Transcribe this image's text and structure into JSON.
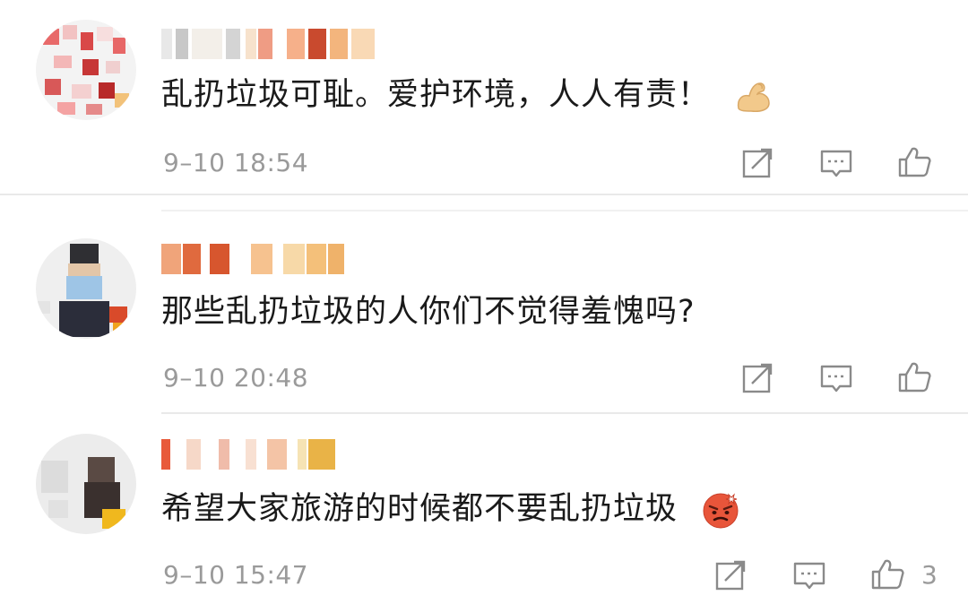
{
  "comments": [
    {
      "text": "乱扔垃圾可耻。爱护环境，人人有责！",
      "emoji": "flexed-biceps-icon",
      "time": "9–10 18:54",
      "likes": ""
    },
    {
      "text": "那些乱扔垃圾的人你们不觉得羞愧吗?",
      "emoji": "",
      "time": "9–10 20:48",
      "likes": ""
    },
    {
      "text": "希望大家旅游的时候都不要乱扔垃圾",
      "emoji": "angry-face-icon",
      "time": "9–10 15:47",
      "likes": "3"
    }
  ],
  "actions": {
    "share_icon": "share-icon",
    "reply_icon": "comment-icon",
    "like_icon": "thumbs-up-icon"
  },
  "colors": {
    "text": "#1a1a1a",
    "meta": "#9a9a9a",
    "divider": "#e9e9e9"
  }
}
